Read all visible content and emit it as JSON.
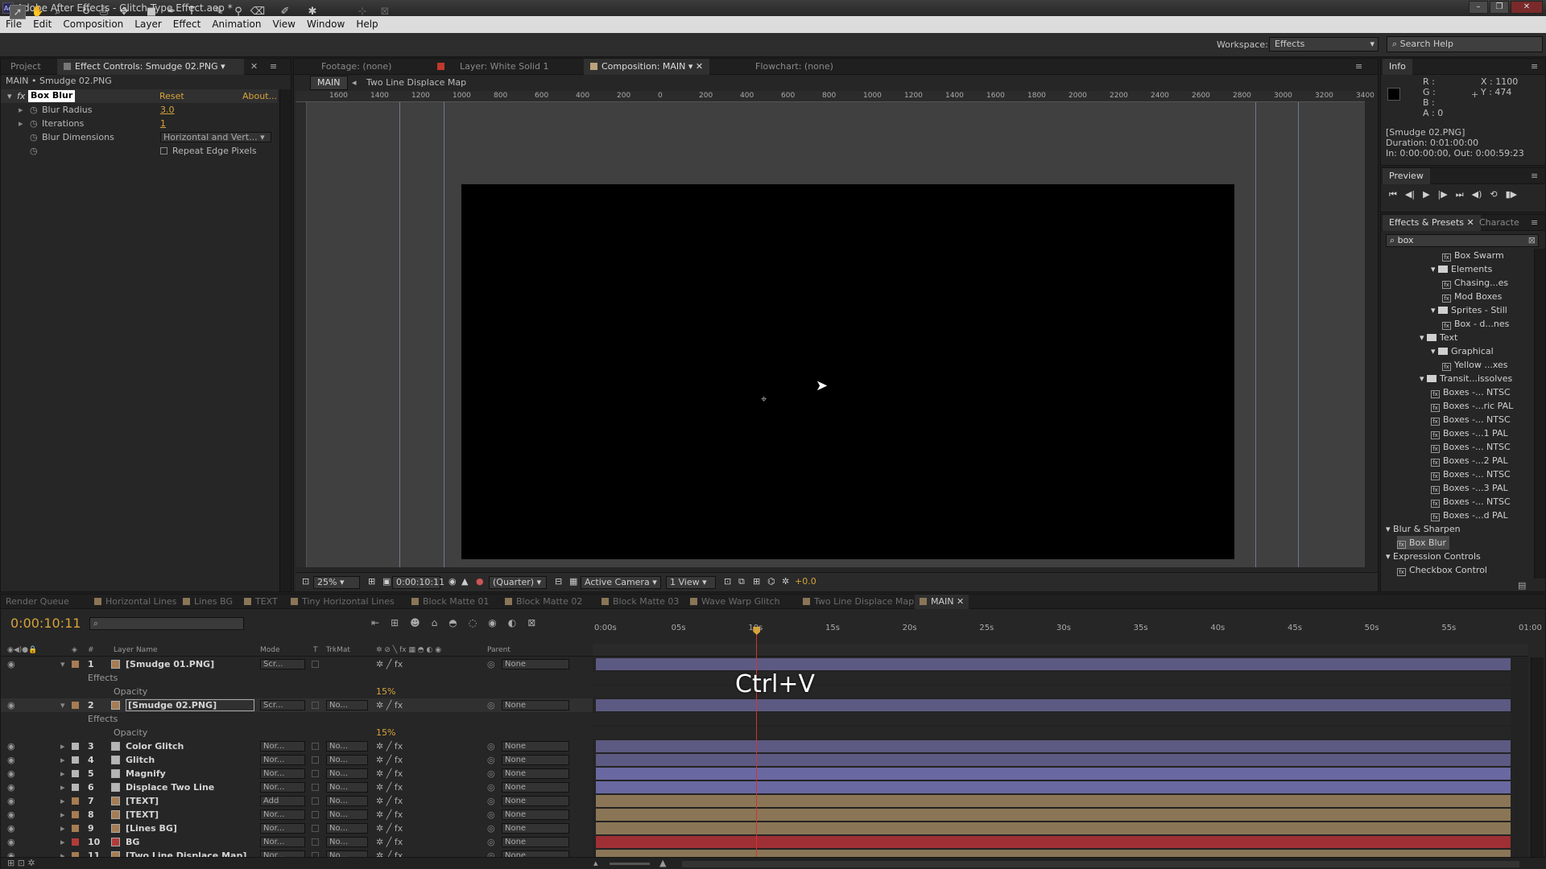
{
  "window": {
    "title": "Adobe After Effects - Glitch Type Effect.aep *",
    "app_icon": "Ae",
    "controls": [
      "–",
      "❐",
      "✕"
    ]
  },
  "menu": [
    "File",
    "Edit",
    "Composition",
    "Layer",
    "Effect",
    "Animation",
    "View",
    "Window",
    "Help"
  ],
  "toolbar": {
    "workspace_label": "Workspace:",
    "workspace_value": "Effects",
    "search_help_placeholder": "Search Help"
  },
  "left_panel": {
    "tabs": [
      "Project",
      "Effect Controls: Smudge 02.PNG"
    ],
    "breadcrumb": "MAIN • Smudge 02.PNG",
    "effect_name": "Box Blur",
    "reset": "Reset",
    "about": "About...",
    "props": [
      {
        "label": "Blur Radius",
        "value": "3.0"
      },
      {
        "label": "Iterations",
        "value": "1"
      },
      {
        "label": "Blur Dimensions",
        "value": "Horizontal and Vert..."
      },
      {
        "label": "",
        "value": "Repeat Edge Pixels"
      }
    ]
  },
  "viewer": {
    "tabs": [
      "Footage: (none)",
      "Layer: White Solid 1",
      "Composition: MAIN",
      "Flowchart: (none)"
    ],
    "nav": [
      "MAIN",
      "Two Line Displace Map"
    ],
    "ruler_labels": [
      "1600",
      "1400",
      "1200",
      "1000",
      "800",
      "600",
      "400",
      "200",
      "0",
      "200",
      "400",
      "600",
      "800",
      "1000",
      "1200",
      "1400",
      "1600",
      "1800",
      "2000",
      "2200",
      "2400",
      "2600",
      "2800",
      "3000",
      "3200",
      "3400"
    ],
    "bottom_bar": {
      "zoom": "25%",
      "timecode": "0:00:10:11",
      "resolution": "(Quarter)",
      "camera": "Active Camera",
      "views": "1 View",
      "exposure": "+0.0"
    }
  },
  "info_panel": {
    "tab": "Info",
    "r": "R :",
    "g": "G :",
    "b": "B :",
    "a": "A : 0",
    "x": "X : 1100",
    "y": "Y : 474",
    "layer": "[Smudge 02.PNG]",
    "duration": "Duration: 0:01:00:00",
    "in_out": "In: 0:00:00:00, Out: 0:00:59:23"
  },
  "preview_panel": {
    "tab": "Preview"
  },
  "effects_presets": {
    "tabs": [
      "Effects & Presets",
      "Characte"
    ],
    "search": "box",
    "items": [
      {
        "label": "Box Swarm",
        "indent": 5,
        "kind": "fx"
      },
      {
        "label": "Elements",
        "indent": 4,
        "kind": "folder"
      },
      {
        "label": "Chasing...es",
        "indent": 5,
        "kind": "fx"
      },
      {
        "label": "Mod Boxes",
        "indent": 5,
        "kind": "fx"
      },
      {
        "label": "Sprites - Still",
        "indent": 4,
        "kind": "folder"
      },
      {
        "label": "Box - d...nes",
        "indent": 5,
        "kind": "fx"
      },
      {
        "label": "Text",
        "indent": 3,
        "kind": "folder"
      },
      {
        "label": "Graphical",
        "indent": 4,
        "kind": "folder"
      },
      {
        "label": "Yellow ...xes",
        "indent": 5,
        "kind": "fx"
      },
      {
        "label": "Transit...issolves",
        "indent": 3,
        "kind": "folder"
      },
      {
        "label": "Boxes -... NTSC",
        "indent": 4,
        "kind": "fx"
      },
      {
        "label": "Boxes -...ric PAL",
        "indent": 4,
        "kind": "fx"
      },
      {
        "label": "Boxes -... NTSC",
        "indent": 4,
        "kind": "fx"
      },
      {
        "label": "Boxes -...1 PAL",
        "indent": 4,
        "kind": "fx"
      },
      {
        "label": "Boxes -... NTSC",
        "indent": 4,
        "kind": "fx"
      },
      {
        "label": "Boxes -...2 PAL",
        "indent": 4,
        "kind": "fx"
      },
      {
        "label": "Boxes -... NTSC",
        "indent": 4,
        "kind": "fx"
      },
      {
        "label": "Boxes -...3 PAL",
        "indent": 4,
        "kind": "fx"
      },
      {
        "label": "Boxes -... NTSC",
        "indent": 4,
        "kind": "fx"
      },
      {
        "label": "Boxes -...d PAL",
        "indent": 4,
        "kind": "fx"
      },
      {
        "label": "Blur & Sharpen",
        "indent": 0,
        "kind": "category"
      },
      {
        "label": "Box Blur",
        "indent": 1,
        "kind": "fx-selected"
      },
      {
        "label": "Expression Controls",
        "indent": 0,
        "kind": "category"
      },
      {
        "label": "Checkbox Control",
        "indent": 1,
        "kind": "fx"
      }
    ]
  },
  "timeline": {
    "tabs": [
      "Render Queue",
      "Horizontal Lines",
      "Lines BG",
      "TEXT",
      "Tiny Horizontal Lines",
      "Block Matte 01",
      "Block Matte 02",
      "Block Matte 03",
      "Wave Warp Glitch",
      "Two Line Displace Map",
      "MAIN"
    ],
    "timecode": "0:00:10:11",
    "columns": {
      "layer_name": "Layer Name",
      "mode": "Mode",
      "t": "T",
      "trkmat": "TrkMat",
      "parent": "Parent",
      "num": "#"
    },
    "time_labels": [
      "0:00s",
      "05s",
      "10s",
      "15s",
      "20s",
      "25s",
      "30s",
      "35s",
      "40s",
      "45s",
      "50s",
      "55s",
      "01:00"
    ],
    "playhead_frac": 0.1736,
    "overlay_hint": "Ctrl+V",
    "sub_effects": "Effects",
    "sub_opacity": "Opacity",
    "sub_opacity_value": "15%",
    "layers": [
      {
        "num": "1",
        "name": "[Smudge 01.PNG]",
        "mode": "Scr...",
        "trk": "",
        "parent": "None",
        "color": "#a67c52",
        "bar": "#5c5a82"
      },
      {
        "num": "2",
        "name": "[Smudge 02.PNG]",
        "mode": "Scr...",
        "trk": "No...",
        "parent": "None",
        "color": "#a67c52",
        "bar": "#5c5a82",
        "selected": true
      },
      {
        "num": "3",
        "name": "Color Glitch",
        "mode": "Nor...",
        "trk": "No...",
        "parent": "None",
        "color": "#b5b5b5",
        "bar": "#5c5a82"
      },
      {
        "num": "4",
        "name": "Glitch",
        "mode": "Nor...",
        "trk": "No...",
        "parent": "None",
        "color": "#b5b5b5",
        "bar": "#5c5a82"
      },
      {
        "num": "5",
        "name": "Magnify",
        "mode": "Nor...",
        "trk": "No...",
        "parent": "None",
        "color": "#b5b5b5",
        "bar": "#6a68a0"
      },
      {
        "num": "6",
        "name": "Displace Two Line",
        "mode": "Nor...",
        "trk": "No...",
        "parent": "None",
        "color": "#b5b5b5",
        "bar": "#6a68a0"
      },
      {
        "num": "7",
        "name": "[TEXT]",
        "mode": "Add",
        "trk": "No...",
        "parent": "None",
        "color": "#a67c52",
        "bar": "#8a7656"
      },
      {
        "num": "8",
        "name": "[TEXT]",
        "mode": "Nor...",
        "trk": "No...",
        "parent": "None",
        "color": "#a67c52",
        "bar": "#8a7656"
      },
      {
        "num": "9",
        "name": "[Lines BG]",
        "mode": "Nor...",
        "trk": "No...",
        "parent": "None",
        "color": "#a67c52",
        "bar": "#8a7656"
      },
      {
        "num": "10",
        "name": "BG",
        "mode": "Nor...",
        "trk": "No...",
        "parent": "None",
        "color": "#b33a3a",
        "bar": "#9e2f35"
      },
      {
        "num": "11",
        "name": "[Two Line Displace Map]",
        "mode": "Nor...",
        "trk": "No...",
        "parent": "None",
        "color": "#a67c52",
        "bar": "#8a7656"
      }
    ]
  },
  "colors": {
    "accent_time": "#d6a33b",
    "playhead": "#d33333"
  }
}
